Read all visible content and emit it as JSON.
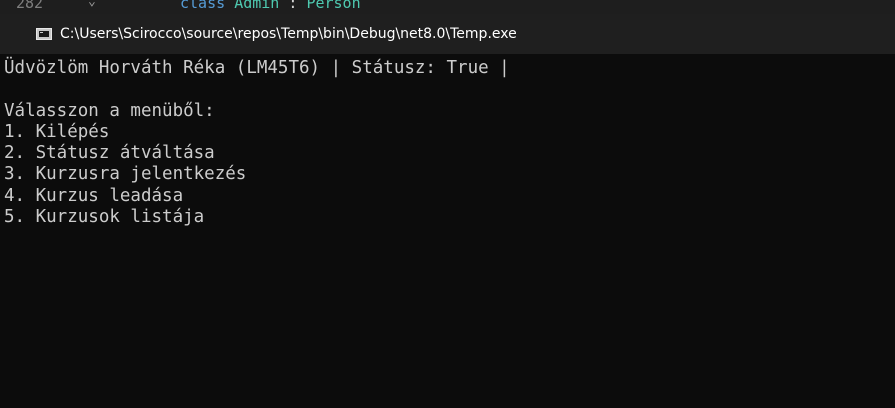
{
  "editor_background": {
    "line_number": "282",
    "fold_marker": "⌄",
    "code_keyword": "class",
    "code_type": "Admin",
    "code_separator": " : ",
    "code_base": "Person"
  },
  "window": {
    "title": "C:\\Users\\Scirocco\\source\\repos\\Temp\\bin\\Debug\\net8.0\\Temp.exe",
    "icon": "console-app-icon"
  },
  "console": {
    "lines": [
      "Üdvözlöm Horváth Réka (LM45T6) | Státusz: True |",
      "",
      "Válasszon a menüből:",
      "1. Kilépés",
      "2. Státusz átváltása",
      "3. Kurzusra jelentkezés",
      "4. Kurzus leadása",
      "5. Kurzusok listája"
    ]
  },
  "colors": {
    "console_bg": "#0c0c0c",
    "console_fg": "#cccccc",
    "titlebar_bg": "#1f1f1f",
    "title_fg": "#ffffff"
  }
}
